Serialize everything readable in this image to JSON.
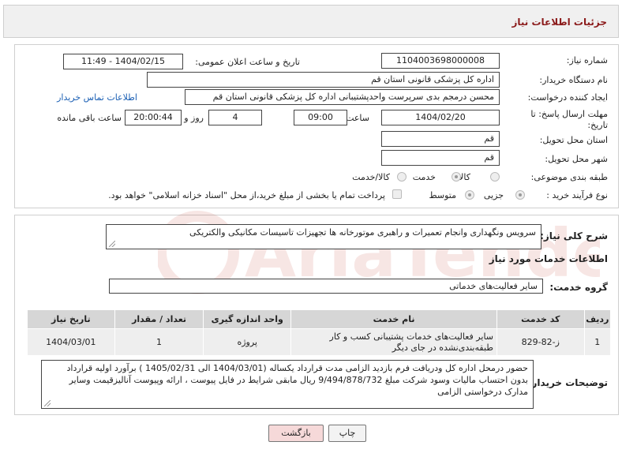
{
  "header": {
    "title": "جزئیات اطلاعات نیاز"
  },
  "form": {
    "need_number_label": "شماره نیاز:",
    "need_number": "1104003698000008",
    "announce_label": "تاریخ و ساعت اعلان عمومی:",
    "announce_value": "1404/02/15 - 11:49",
    "buyer_org_label": "نام دستگاه خریدار:",
    "buyer_org": "اداره کل پزشکی قانونی استان قم",
    "creator_label": "ایجاد کننده درخواست:",
    "creator": "محسن درمجم بدی سرپرست واحدپشتیبانی اداره کل پزشکی قانونی استان قم",
    "contact_link": "اطلاعات تماس خریدار",
    "deadline_label": "مهلت ارسال پاسخ: تا تاریخ:",
    "deadline_date": "1404/02/20",
    "time_label": "ساعت",
    "deadline_time": "09:00",
    "days_value": "4",
    "days_label": "روز و",
    "remaining_time": "20:00:44",
    "remaining_label": "ساعت باقی مانده",
    "province_label": "استان محل تحویل:",
    "province": "قم",
    "city_label": "شهر محل تحویل:",
    "city": "قم",
    "category_label": "طبقه بندی موضوعی:",
    "category_options": [
      "کالا",
      "خدمت",
      "کالا/خدمت"
    ],
    "category_selected": "خدمت",
    "process_label": "نوع فرآیند خرید :",
    "process_options": [
      "جزیی",
      "متوسط"
    ],
    "process_selected": "جزیی",
    "treasury_note": "پرداخت تمام یا بخشی از مبلغ خرید،از محل \"اسناد خزانه اسلامی\" خواهد بود."
  },
  "details": {
    "description_label": "شرح کلی نیاز:",
    "description": "سرویس ونگهداری وانجام تعمیرات و راهبری موتورخانه ها تجهیزات تاسیسات مکانیکی والکتریکی",
    "services_heading": "اطلاعات خدمات مورد نیاز",
    "service_group_label": "گروه خدمت:",
    "service_group": "سایر فعالیت‌های خدماتی",
    "table": {
      "headers": [
        "ردیف",
        "کد خدمت",
        "نام خدمت",
        "واحد اندازه گیری",
        "تعداد / مقدار",
        "تاریخ نیاز"
      ],
      "rows": [
        [
          "1",
          "ز-82-829",
          "سایر فعالیت‌های خدمات پشتیبانی کسب و کار طبقه‌بندی‌نشده در جای دیگر",
          "پروژه",
          "1",
          "1404/03/01"
        ]
      ]
    },
    "buyer_notes_label": "توضیحات خریدار:",
    "buyer_notes": "حضور درمحل اداره کل ودریافت فرم بازدید الزامی مدت قرارداد یکساله (1404/03/01 الی 1405/02/31 ) برآورد اولیه قرارداد بدون احتساب مالیات وسود شرکت مبلغ 9/494/878/732 ریال مابقی شرایط در فایل پیوست ، ارائه  وپیوست آنالیزقیمت وسایر مدارک درخواستی الزامی"
  },
  "buttons": {
    "print": "چاپ",
    "back": "بازگشت"
  },
  "watermark": {
    "text": "AriaTender.net",
    "color": "#c0392b"
  }
}
